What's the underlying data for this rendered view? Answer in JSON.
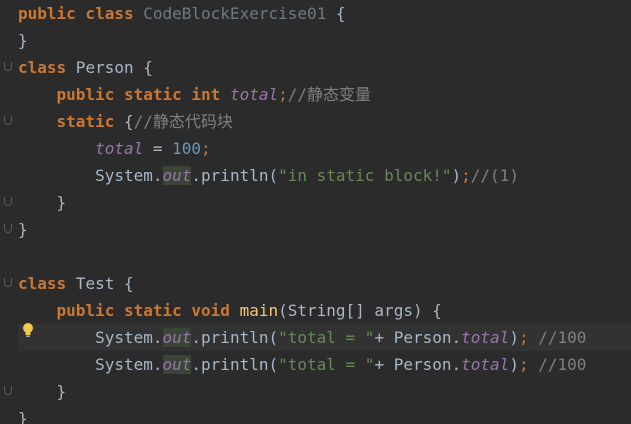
{
  "lines": [
    {
      "tokens": [
        {
          "c": "kw",
          "t": "public class"
        },
        {
          "c": "plain",
          "t": " "
        },
        {
          "c": "cls-grey",
          "t": "CodeBlockExercise01"
        },
        {
          "c": "plain",
          "t": " {"
        }
      ]
    },
    {
      "tokens": [
        {
          "c": "plain",
          "t": "}"
        }
      ]
    },
    {
      "tokens": [
        {
          "c": "kw",
          "t": "class"
        },
        {
          "c": "plain",
          "t": " Person {"
        }
      ]
    },
    {
      "tokens": [
        {
          "c": "plain",
          "t": "    "
        },
        {
          "c": "kw",
          "t": "public static int"
        },
        {
          "c": "plain",
          "t": " "
        },
        {
          "c": "field",
          "t": "total"
        },
        {
          "c": "semi",
          "t": ";"
        },
        {
          "c": "cmt",
          "t": "//静态变量"
        }
      ]
    },
    {
      "tokens": [
        {
          "c": "plain",
          "t": "    "
        },
        {
          "c": "kw",
          "t": "static"
        },
        {
          "c": "plain",
          "t": " {"
        },
        {
          "c": "cmt",
          "t": "//静态代码块"
        }
      ]
    },
    {
      "tokens": [
        {
          "c": "plain",
          "t": "        "
        },
        {
          "c": "field",
          "t": "total"
        },
        {
          "c": "plain",
          "t": " = "
        },
        {
          "c": "num",
          "t": "100"
        },
        {
          "c": "semi",
          "t": ";"
        }
      ]
    },
    {
      "tokens": [
        {
          "c": "plain",
          "t": "        System."
        },
        {
          "c": "out-field",
          "t": "out"
        },
        {
          "c": "plain",
          "t": ".println("
        },
        {
          "c": "str",
          "t": "\"in static block!\""
        },
        {
          "c": "plain",
          "t": ")"
        },
        {
          "c": "semi",
          "t": ";"
        },
        {
          "c": "cmt",
          "t": "//(1)"
        }
      ]
    },
    {
      "tokens": [
        {
          "c": "plain",
          "t": "    }"
        }
      ]
    },
    {
      "tokens": [
        {
          "c": "plain",
          "t": "}"
        }
      ]
    },
    {
      "tokens": []
    },
    {
      "tokens": [
        {
          "c": "kw",
          "t": "class"
        },
        {
          "c": "plain",
          "t": " Test {"
        }
      ]
    },
    {
      "tokens": [
        {
          "c": "plain",
          "t": "    "
        },
        {
          "c": "kw",
          "t": "public static void"
        },
        {
          "c": "plain",
          "t": " "
        },
        {
          "c": "fn",
          "t": "main"
        },
        {
          "c": "plain",
          "t": "(String[] args) {"
        }
      ]
    },
    {
      "tokens": [
        {
          "c": "plain",
          "t": "        System."
        },
        {
          "c": "out-field",
          "t": "out"
        },
        {
          "c": "plain",
          "t": ".println("
        },
        {
          "c": "str",
          "t": "\"total = \""
        },
        {
          "c": "plain",
          "t": "+ Person."
        },
        {
          "c": "field",
          "t": "total"
        },
        {
          "c": "plain",
          "t": ")"
        },
        {
          "c": "semi",
          "t": ";"
        },
        {
          "c": "plain",
          "t": " "
        },
        {
          "c": "cmt",
          "t": "//100"
        }
      ],
      "current": true
    },
    {
      "tokens": [
        {
          "c": "plain",
          "t": "        System."
        },
        {
          "c": "out-field",
          "t": "out"
        },
        {
          "c": "plain",
          "t": ".println("
        },
        {
          "c": "str",
          "t": "\"total = \""
        },
        {
          "c": "plain",
          "t": "+ Person."
        },
        {
          "c": "field",
          "t": "total"
        },
        {
          "c": "plain",
          "t": ")"
        },
        {
          "c": "semi",
          "t": ";"
        },
        {
          "c": "plain",
          "t": " "
        },
        {
          "c": "cmt",
          "t": "//100"
        }
      ]
    },
    {
      "tokens": [
        {
          "c": "plain",
          "t": "    }"
        }
      ]
    },
    {
      "tokens": [
        {
          "c": "plain",
          "t": "}"
        }
      ]
    }
  ],
  "colors": {
    "background": "#2b2b2b",
    "keyword": "#cc7832",
    "field": "#9876aa",
    "number": "#6897bb",
    "string": "#6a8759",
    "comment": "#808080",
    "text": "#a9b7c6",
    "bulb": "#f2c94c"
  },
  "gutter_icons": [
    "lightbulb-icon"
  ]
}
